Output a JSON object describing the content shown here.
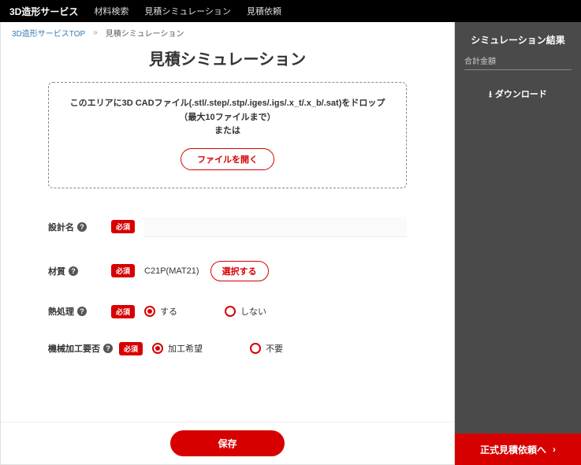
{
  "topbar": {
    "brand": "3D造形サービス",
    "nav": [
      "材料検索",
      "見積シミュレーション",
      "見積依頼"
    ]
  },
  "breadcrumb": {
    "top": "3D造形サービスTOP",
    "sep": "»",
    "current": "見積シミュレーション"
  },
  "page_title": "見積シミュレーション",
  "drop": {
    "line1": "このエリアに3D CADファイル(.stl/.step/.stp/.iges/.igs/.x_t/.x_b/.sat)をドロップ",
    "line2": "（最大10ファイルまで）",
    "line3": "または",
    "open": "ファイルを開く"
  },
  "form": {
    "required": "必須",
    "design": {
      "label": "設計名",
      "value": ""
    },
    "material": {
      "label": "材質",
      "value": "C21P(MAT21)",
      "select": "選択する"
    },
    "heat": {
      "label": "熱処理",
      "opt1": "する",
      "opt2": "しない"
    },
    "machining": {
      "label": "機械加工要否",
      "opt1": "加工希望",
      "opt2": "不要"
    }
  },
  "footer": {
    "save": "保存"
  },
  "sidebar": {
    "title": "シミュレーション結果",
    "total_label": "合計金額",
    "download": "ダウンロード",
    "formal": "正式見積依頼へ"
  }
}
